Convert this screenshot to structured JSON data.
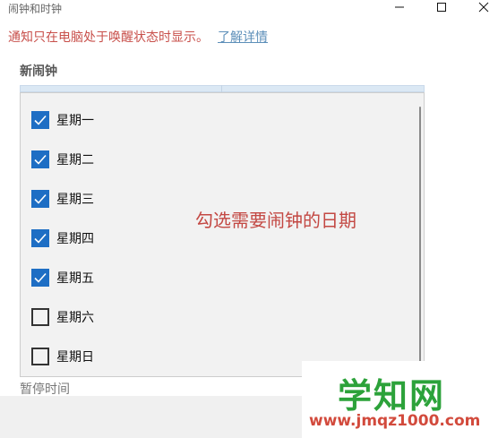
{
  "window": {
    "title": "闹钟和时钟"
  },
  "notice": {
    "text": "通知只在电脑处于唤醒状态时显示。",
    "link": "了解详情"
  },
  "section": {
    "title": "新闹钟"
  },
  "days": [
    {
      "label": "星期一",
      "checked": true
    },
    {
      "label": "星期二",
      "checked": true
    },
    {
      "label": "星期三",
      "checked": true
    },
    {
      "label": "星期四",
      "checked": true
    },
    {
      "label": "星期五",
      "checked": true
    },
    {
      "label": "星期六",
      "checked": false
    },
    {
      "label": "星期日",
      "checked": false
    }
  ],
  "annotation": "勾选需要闹钟的日期",
  "pause_label": "暂停时间",
  "watermark": {
    "main": "学知网",
    "sub": "www.jmqz1000.com"
  },
  "colors": {
    "check_accent": "#1e6ec4",
    "notice_red": "#c8504b",
    "link_blue": "#5d8fb9",
    "annotation_red": "#c34843",
    "watermark_green": "#2ca23a",
    "watermark_red": "#d24a3c"
  }
}
